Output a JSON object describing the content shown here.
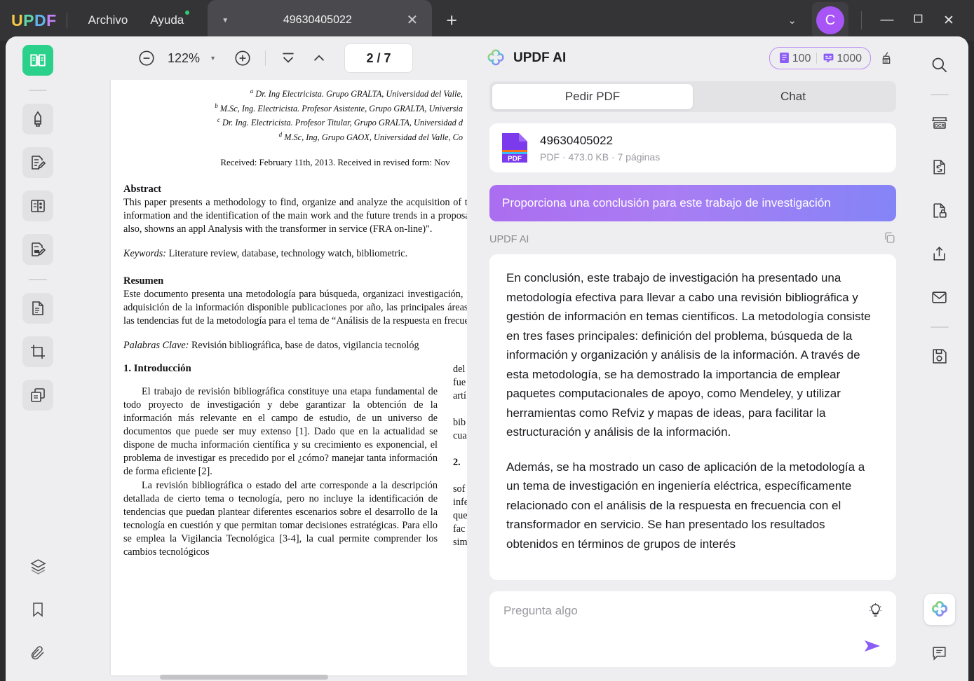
{
  "titlebar": {
    "logo_letters": [
      "U",
      "P",
      "D",
      "F"
    ],
    "menus": [
      {
        "label": "Archivo",
        "dot": false
      },
      {
        "label": "Ayuda",
        "dot": true
      }
    ],
    "tab": {
      "title": "49630405022",
      "caret": "▼",
      "close": "✕"
    },
    "new_tab": "+",
    "chevron": "⌄",
    "avatar_initial": "C",
    "window": {
      "minimize": "—",
      "maximize": "▢",
      "close": "✕"
    }
  },
  "left_rail": {
    "items": [
      {
        "name": "reader",
        "state": "active-green"
      },
      {
        "name": "divider",
        "state": "divider"
      },
      {
        "name": "annotate-highlighter",
        "state": "boxed"
      },
      {
        "name": "edit-pdf",
        "state": "boxed"
      },
      {
        "name": "organize-pages",
        "state": "boxed"
      },
      {
        "name": "fill-and-sign",
        "state": "boxed"
      },
      {
        "name": "divider",
        "state": "divider"
      },
      {
        "name": "convert-pdf",
        "state": "boxed"
      },
      {
        "name": "crop-pages",
        "state": "boxed"
      },
      {
        "name": "batch-process",
        "state": "boxed"
      }
    ],
    "bottom_items": [
      {
        "name": "layers",
        "state": "plain"
      },
      {
        "name": "bookmark",
        "state": "plain"
      },
      {
        "name": "attachment",
        "state": "plain"
      }
    ]
  },
  "right_rail": {
    "items": [
      {
        "name": "search",
        "state": "plain"
      },
      {
        "name": "divider",
        "state": "divider"
      },
      {
        "name": "ocr",
        "state": "plain"
      },
      {
        "name": "convert",
        "state": "plain"
      },
      {
        "name": "protect",
        "state": "plain"
      },
      {
        "name": "share",
        "state": "plain"
      },
      {
        "name": "email",
        "state": "plain"
      },
      {
        "name": "divider",
        "state": "divider"
      },
      {
        "name": "save",
        "state": "plain"
      }
    ],
    "bottom_items": [
      {
        "name": "updf-ai",
        "state": "active-white"
      },
      {
        "name": "comment",
        "state": "plain"
      }
    ]
  },
  "viewer_toolbar": {
    "zoom_out": "−",
    "zoom_level": "122%",
    "zoom_caret": "▼",
    "zoom_in": "+",
    "first_page": "first-page-icon",
    "prev_page": "previous-page-icon",
    "page_indicator": "2 / 7",
    "current_page": 2,
    "total_pages": 7
  },
  "document": {
    "affiliations": [
      {
        "mark": "a",
        "text": "Dr. Ing Electricista. Grupo GRALTA, Universidad del Valle,"
      },
      {
        "mark": "b",
        "text": "M.Sc, Ing. Electricista. Profesor Asistente, Grupo GRALTA, Universia"
      },
      {
        "mark": "c",
        "text": "Dr. Ing. Electricista. Profesor Titular, Grupo GRALTA, Universidad d"
      },
      {
        "mark": "d",
        "text": "M.Sc, Ing, Grupo GAOX, Universidad del Valle, Co"
      }
    ],
    "received": "Received: February 11th, 2013. Received in revised form: Nov",
    "abstract_heading": "Abstract",
    "abstract_text": "This paper presents a methodology to find, organize and analyze the acquisition of the available information and the identification of the main work and the future trends in a proposal topic. It is also, showns an appl Analysis with the transformer in service (FRA on-line)\".",
    "keywords_label": "Keywords:",
    "keywords_text": " Literature review, database, technology watch, bibliometric.",
    "resumen_heading": "Resumen",
    "resumen_text": "Este documento presenta una metodología para búsqueda, organizaci investigación, facilitando la adquisición de la información disponible publicaciones por año, las principales áreas de trabajo y las tendencias fut de la metodología para el tema  de “Análisis de la respuesta en frecuencia",
    "palabras_label": "Palabras Clave:",
    "palabras_text": " Revisión bibliográfica, base de datos, vigilancia tecnológ",
    "intro_heading": "1. Introducción",
    "intro_p1": "El trabajo de revisión bibliográfica constituye una etapa fundamental de todo proyecto de investigación y debe garantizar la obtención de la información más relevante en el campo de estudio, de un universo de documentos que puede ser muy extenso [1]. Dado que en la actualidad se dispone de mucha información científica y su crecimiento es exponencial, el problema de investigar es precedido por el ¿cómo? manejar tanta información de forma eficiente [2].",
    "intro_p2": "La revisión bibliográfica o estado del arte corresponde a la  descripción detallada de cierto tema o  tecnología, pero no incluye la identificación de   tendencias que puedan plantear diferentes escenarios sobre el desarrollo de la tecnología en cuestión y que permitan tomar decisiones estratégicas. Para ello se emplea la Vigilancia Tecnológica [3-4], la cual permite comprender los cambios tecnológicos",
    "right_col_fragments": [
      "del",
      "fue",
      "artí",
      "",
      "bib",
      "cua",
      "",
      "2.",
      "",
      "sof",
      "infe",
      "que",
      "fac",
      "sim"
    ]
  },
  "ai": {
    "panel_title": "UPDF AI",
    "credits": {
      "doc_count": "100",
      "chat_count": "1000"
    },
    "clear_icon": "broom-icon",
    "tabs": [
      {
        "label": "Pedir PDF",
        "selected": true
      },
      {
        "label": "Chat",
        "selected": false
      }
    ],
    "file": {
      "name": "49630405022",
      "meta": "PDF · 473.0 KB · 7 páginas"
    },
    "user_prompt": "Proporciona una conclusión para este trabajo de investigación",
    "sender_label": "UPDF AI",
    "answer_paragraphs": [
      "En conclusión, este trabajo de investigación ha presentado una metodología efectiva para llevar a cabo una revisión bibliográfica y gestión de información en temas científicos. La metodología consiste en tres fases principales: definición del problema, búsqueda de la información y organización y análisis de la información. A través de esta metodología, se ha demostrado la importancia de emplear paquetes computacionales de apoyo, como Mendeley, y utilizar herramientas como Refviz y mapas de ideas, para facilitar la estructuración y análisis de la información.",
      "Además, se ha mostrado un caso de aplicación de la metodología a un tema de investigación en ingeniería eléctrica, específicamente relacionado con el análisis de la respuesta en frecuencia con el transformador en servicio. Se han presentado los resultados obtenidos en términos de grupos de interés"
    ],
    "composer_placeholder": "Pregunta algo",
    "hint_icon": "lightbulb-icon",
    "send_icon": "send-icon"
  },
  "colors": {
    "accent_purple": "#8b5cf6",
    "accent_green": "#2bd18b",
    "titlebar_bg": "#343437",
    "workspace_bg": "#eeeef0"
  }
}
